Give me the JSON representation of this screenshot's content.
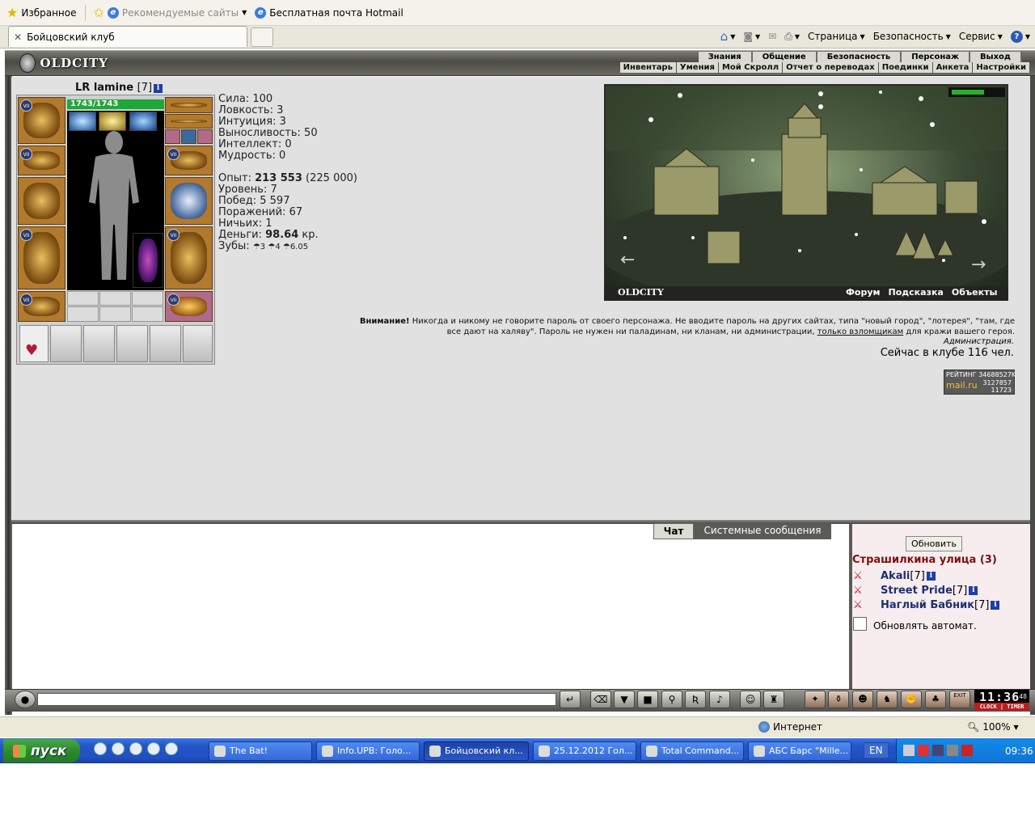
{
  "browser": {
    "favorites_label": "Избранное",
    "recommended_label": "Рекомендуемые сайты",
    "hotmail_label": "Бесплатная почта Hotmail",
    "tab_title": "Бойцовский клуб",
    "cmd_page": "Страница",
    "cmd_security": "Безопасность",
    "cmd_service": "Сервис",
    "status_zone": "Интернет",
    "zoom": "100%"
  },
  "game": {
    "logo": "OLDCITY",
    "menu_top": [
      "Знания",
      "Общение",
      "Безопасность",
      "Персонаж",
      "Выход"
    ],
    "menu_sub": [
      "Инвентарь",
      "Умения",
      "Мой Скролл",
      "Отчет о переводах",
      "Поединки",
      "Анкета",
      "Настройки"
    ],
    "character": {
      "name": "LR lamine",
      "level": "[7]",
      "hp": "1743/1743",
      "slot_badge": "VII",
      "stats": {
        "sila": "Сила: 100",
        "lovkost": "Ловкость: 3",
        "intuition": "Интуиция: 3",
        "endurance": "Выносливость: 50",
        "intellect": "Интеллект: 0",
        "wisdom": "Мудрость: 0"
      },
      "exp_label": "Опыт:",
      "exp_value": "213 553",
      "exp_next": "(225 000)",
      "level_line": "Уровень: 7",
      "wins": "Побед: 5 597",
      "losses": "Поражений: 67",
      "draws": "Ничьих: 1",
      "money_label": "Деньги:",
      "money_value": "98.64",
      "money_unit": "кр.",
      "teeth_label": "Зубы:",
      "teeth_value": "☂3 ☂4 ☂6.05"
    },
    "scene": {
      "logo": "OLDCITY",
      "links": [
        "Форум",
        "Подсказка",
        "Объекты"
      ]
    },
    "warning": {
      "bold": "Внимание!",
      "text1": " Никогда и никому не говорите пароль от своего персонажа. Не вводите пароль на других сайтах, типа \"новый город\", \"лотерея\", \"там, где все дают на халяву\". Пароль не нужен ни паладинам, ни кланам, ни администрации, ",
      "link": "только взломщикам",
      "text2": " для кражи вашего героя."
    },
    "admin": "Администрация.",
    "online": "Сейчас в клубе 116 чел.",
    "rating": {
      "label": "РЕЙТИНГ",
      "code": "34688527K",
      "brand": "mail.ru",
      "n1": "3127857",
      "n2": "11723"
    },
    "chat": {
      "tab_chat": "Чат",
      "tab_system": "Системные сообщения",
      "refresh": "Обновить",
      "location": "Страшилкина улица (3)",
      "players": [
        {
          "name": "Akali",
          "level": "[7]"
        },
        {
          "name": "Street Pride",
          "level": "[7]"
        },
        {
          "name": "Наглый Бабник",
          "level": "[7]"
        }
      ],
      "auto_refresh": "Обновлять автомат."
    },
    "clock": {
      "time": "11:36",
      "seconds": "48",
      "exit": "EXIT",
      "labels": "CLOCK | TIMER"
    }
  },
  "taskbar": {
    "start": "пуск",
    "tasks": [
      "The Bat!",
      "Info.UPB: Голо...",
      "Бойцовский кл...",
      "25.12.2012 Гол...",
      "Total Command...",
      "АБС Барс \"Mille..."
    ],
    "lang": "EN",
    "time": "09:36"
  }
}
